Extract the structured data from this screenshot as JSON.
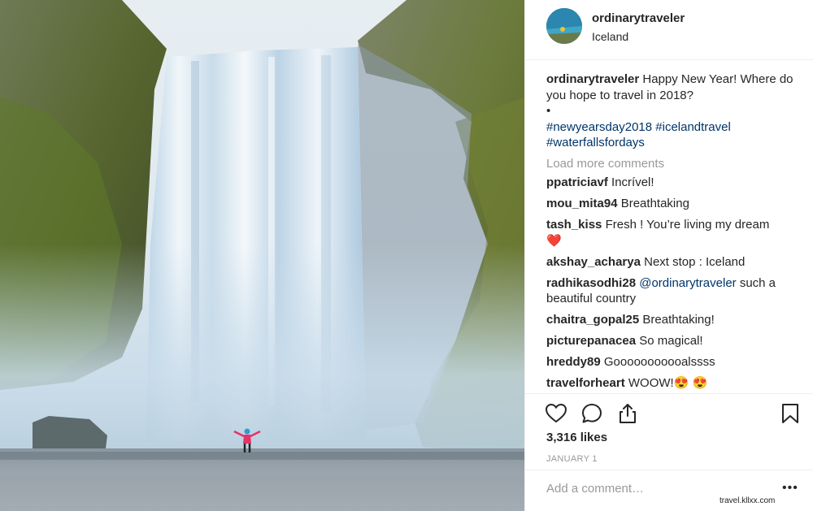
{
  "post": {
    "username": "ordinarytraveler",
    "location": "Iceland",
    "caption_user": "ordinarytraveler",
    "caption_text": "Happy New Year! Where do you hope to travel in 2018?",
    "caption_bullet": "•",
    "hashtags": [
      "#newyearsday2018",
      "#icelandtravel",
      "#waterfallsfordays"
    ],
    "load_more": "Load more comments",
    "likes": "3,316 likes",
    "date": "JANUARY 1",
    "add_comment_placeholder": "Add a comment…",
    "more_options": "•••"
  },
  "comments": [
    {
      "user": "ppatriciavf",
      "text": "Incrível!"
    },
    {
      "user": "mou_mita94",
      "text": "Breathtaking"
    },
    {
      "user": "tash_kiss",
      "text": "Fresh ! You’re living my dream",
      "emoji": "❤️"
    },
    {
      "user": "akshay_acharya",
      "text": "Next stop : Iceland"
    },
    {
      "user": "radhikasodhi28",
      "mention": "@ordinarytraveler",
      "text": "such a beautiful country"
    },
    {
      "user": "chaitra_gopal25",
      "text": "Breathtaking!"
    },
    {
      "user": "picturepanacea",
      "text": "So magical!"
    },
    {
      "user": "hreddy89",
      "text": "Gooooooooooalssss"
    },
    {
      "user": "travelforheart",
      "text": "WOOW!😍 😍"
    }
  ],
  "icons": {
    "like": "heart-icon",
    "comment": "comment-bubble-icon",
    "share": "share-icon",
    "save": "bookmark-icon"
  },
  "watermark": "travel.kllxx.com",
  "colors": {
    "hashtag": "#003569",
    "muted": "#999999",
    "text": "#262626",
    "divider": "#efefef"
  }
}
